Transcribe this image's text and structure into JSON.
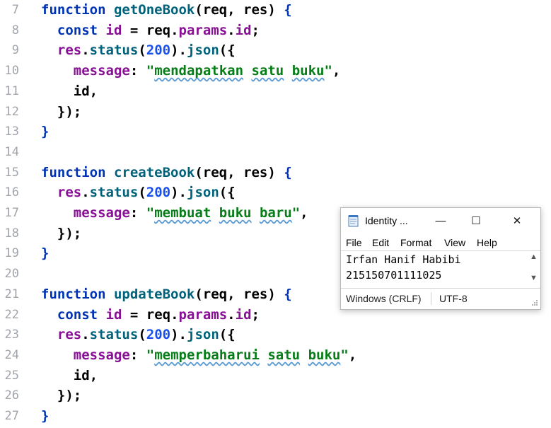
{
  "editor": {
    "lines": [
      {
        "n": "7",
        "tokens": [
          [
            "function ",
            "t-kw"
          ],
          [
            "getOneBook",
            "t-fn"
          ],
          [
            "(",
            "t-par"
          ],
          [
            "req",
            "t-id"
          ],
          [
            ", ",
            "t-punc"
          ],
          [
            "res",
            "t-id"
          ],
          [
            ") ",
            "t-par"
          ],
          [
            "{",
            "t-brace1"
          ]
        ]
      },
      {
        "n": "8",
        "tokens": [
          [
            "  "
          ],
          [
            "const ",
            "t-kw"
          ],
          [
            "id",
            "t-prop"
          ],
          [
            " = ",
            "t-punc"
          ],
          [
            "req",
            "t-id"
          ],
          [
            ".",
            "t-punc"
          ],
          [
            "params",
            "t-prop"
          ],
          [
            ".",
            "t-punc"
          ],
          [
            "id",
            "t-prop"
          ],
          [
            ";",
            "t-punc"
          ]
        ]
      },
      {
        "n": "9",
        "tokens": [
          [
            "  "
          ],
          [
            "res",
            "t-prop"
          ],
          [
            ".",
            "t-punc"
          ],
          [
            "status",
            "t-fn"
          ],
          [
            "(",
            "t-par"
          ],
          [
            "200",
            "t-num"
          ],
          [
            ")",
            "t-par"
          ],
          [
            ".",
            "t-punc"
          ],
          [
            "json",
            "t-fn"
          ],
          [
            "({",
            "t-par"
          ]
        ]
      },
      {
        "n": "10",
        "tokens": [
          [
            "    "
          ],
          [
            "message",
            "t-prop"
          ],
          [
            ": ",
            "t-punc"
          ],
          [
            "\"",
            "t-str"
          ],
          [
            "mendapatkan",
            "t-str t-typo"
          ],
          [
            " ",
            "t-str"
          ],
          [
            "satu",
            "t-str t-typo"
          ],
          [
            " ",
            "t-str"
          ],
          [
            "buku",
            "t-str t-typo"
          ],
          [
            "\"",
            "t-str"
          ],
          [
            ",",
            "t-punc"
          ]
        ]
      },
      {
        "n": "11",
        "tokens": [
          [
            "    "
          ],
          [
            "id",
            "t-id"
          ],
          [
            ",",
            "t-punc"
          ]
        ]
      },
      {
        "n": "12",
        "tokens": [
          [
            "  "
          ],
          [
            "});",
            "t-par"
          ]
        ]
      },
      {
        "n": "13",
        "tokens": [
          [
            "}",
            "t-brace1"
          ]
        ]
      },
      {
        "n": "14",
        "tokens": []
      },
      {
        "n": "15",
        "tokens": [
          [
            "function ",
            "t-kw"
          ],
          [
            "createBook",
            "t-fn"
          ],
          [
            "(",
            "t-par"
          ],
          [
            "req",
            "t-id"
          ],
          [
            ", ",
            "t-punc"
          ],
          [
            "res",
            "t-id"
          ],
          [
            ") ",
            "t-par"
          ],
          [
            "{",
            "t-brace1"
          ]
        ]
      },
      {
        "n": "16",
        "tokens": [
          [
            "  "
          ],
          [
            "res",
            "t-prop"
          ],
          [
            ".",
            "t-punc"
          ],
          [
            "status",
            "t-fn"
          ],
          [
            "(",
            "t-par"
          ],
          [
            "200",
            "t-num"
          ],
          [
            ")",
            "t-par"
          ],
          [
            ".",
            "t-punc"
          ],
          [
            "json",
            "t-fn"
          ],
          [
            "({",
            "t-par"
          ]
        ]
      },
      {
        "n": "17",
        "tokens": [
          [
            "    "
          ],
          [
            "message",
            "t-prop"
          ],
          [
            ": ",
            "t-punc"
          ],
          [
            "\"",
            "t-str"
          ],
          [
            "membuat",
            "t-str t-typo"
          ],
          [
            " ",
            "t-str"
          ],
          [
            "buku",
            "t-str t-typo"
          ],
          [
            " ",
            "t-str"
          ],
          [
            "baru",
            "t-str t-typo"
          ],
          [
            "\"",
            "t-str"
          ],
          [
            ",",
            "t-punc"
          ]
        ]
      },
      {
        "n": "18",
        "tokens": [
          [
            "  "
          ],
          [
            "});",
            "t-par"
          ]
        ]
      },
      {
        "n": "19",
        "tokens": [
          [
            "}",
            "t-brace1"
          ]
        ]
      },
      {
        "n": "20",
        "tokens": []
      },
      {
        "n": "21",
        "tokens": [
          [
            "function ",
            "t-kw"
          ],
          [
            "updateBook",
            "t-fn"
          ],
          [
            "(",
            "t-par"
          ],
          [
            "req",
            "t-id"
          ],
          [
            ", ",
            "t-punc"
          ],
          [
            "res",
            "t-id"
          ],
          [
            ") ",
            "t-par"
          ],
          [
            "{",
            "t-brace1"
          ]
        ]
      },
      {
        "n": "22",
        "tokens": [
          [
            "  "
          ],
          [
            "const ",
            "t-kw"
          ],
          [
            "id",
            "t-prop"
          ],
          [
            " = ",
            "t-punc"
          ],
          [
            "req",
            "t-id"
          ],
          [
            ".",
            "t-punc"
          ],
          [
            "params",
            "t-prop"
          ],
          [
            ".",
            "t-punc"
          ],
          [
            "id",
            "t-prop"
          ],
          [
            ";",
            "t-punc"
          ]
        ]
      },
      {
        "n": "23",
        "tokens": [
          [
            "  "
          ],
          [
            "res",
            "t-prop"
          ],
          [
            ".",
            "t-punc"
          ],
          [
            "status",
            "t-fn"
          ],
          [
            "(",
            "t-par"
          ],
          [
            "200",
            "t-num"
          ],
          [
            ")",
            "t-par"
          ],
          [
            ".",
            "t-punc"
          ],
          [
            "json",
            "t-fn"
          ],
          [
            "({",
            "t-par"
          ]
        ]
      },
      {
        "n": "24",
        "tokens": [
          [
            "    "
          ],
          [
            "message",
            "t-prop"
          ],
          [
            ": ",
            "t-punc"
          ],
          [
            "\"",
            "t-str"
          ],
          [
            "memperbaharui",
            "t-str t-typo"
          ],
          [
            " ",
            "t-str"
          ],
          [
            "satu",
            "t-str t-typo"
          ],
          [
            " ",
            "t-str"
          ],
          [
            "buku",
            "t-str t-typo"
          ],
          [
            "\"",
            "t-str"
          ],
          [
            ",",
            "t-punc"
          ]
        ]
      },
      {
        "n": "25",
        "tokens": [
          [
            "    "
          ],
          [
            "id",
            "t-id"
          ],
          [
            ",",
            "t-punc"
          ]
        ]
      },
      {
        "n": "26",
        "tokens": [
          [
            "  "
          ],
          [
            "});",
            "t-par"
          ]
        ]
      },
      {
        "n": "27",
        "tokens": [
          [
            "}",
            "t-brace1"
          ]
        ]
      }
    ]
  },
  "notepad": {
    "title": "Identity ...",
    "controls": {
      "minimize": "—",
      "maximize": "☐",
      "close": "✕"
    },
    "menu": [
      "File",
      "Edit",
      "Format",
      "View",
      "Help"
    ],
    "text_lines": [
      "Irfan Hanif Habibi",
      "215150701111025"
    ],
    "status": {
      "line_ending": "Windows (CRLF)",
      "encoding": "UTF-8"
    }
  },
  "colors": {
    "keyword": "#0033b3",
    "function": "#00627a",
    "property": "#871094",
    "number": "#1750eb",
    "string": "#067d17",
    "line_number": "#a0a4ab",
    "typo_underline": "#5a9bd5"
  }
}
